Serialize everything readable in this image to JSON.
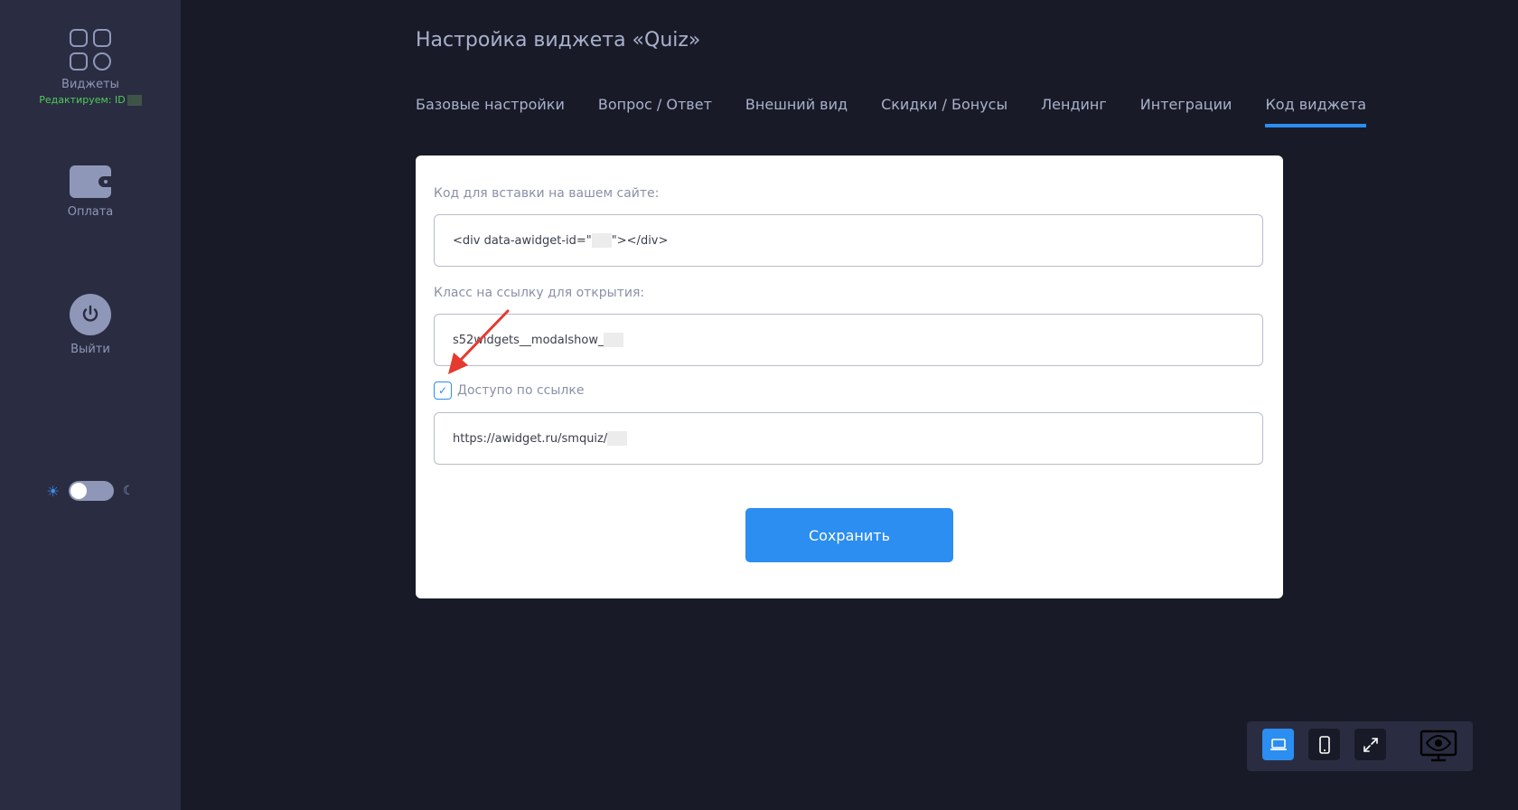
{
  "sidebar": {
    "widgets_label": "Виджеты",
    "editing_label": "Редактируем: ID",
    "payment_label": "Оплата",
    "logout_label": "Выйти"
  },
  "header": {
    "title": "Настройка виджета «Quiz»"
  },
  "tabs": [
    {
      "label": "Базовые настройки"
    },
    {
      "label": "Вопрос / Ответ"
    },
    {
      "label": "Внешний вид"
    },
    {
      "label": "Скидки / Бонусы"
    },
    {
      "label": "Лендинг"
    },
    {
      "label": "Интеграции"
    },
    {
      "label": "Код виджета",
      "active": true
    }
  ],
  "form": {
    "embed_label": "Код для вставки на вашем сайте:",
    "embed_value_prefix": "<div data-awidget-id=\"",
    "embed_value_suffix": "\"></div>",
    "class_label": "Класс на ссылку для открытия:",
    "class_value": "s52widgets__modalshow_",
    "link_access_label": "Доступо по ссылке",
    "link_access_checked": true,
    "link_value": "https://awidget.ru/smquiz/",
    "save_label": "Сохранить"
  },
  "colors": {
    "accent": "#2b8ef0",
    "background": "#181b27",
    "sidebar": "#2a2d41",
    "editing_green": "#4fcb5a"
  }
}
